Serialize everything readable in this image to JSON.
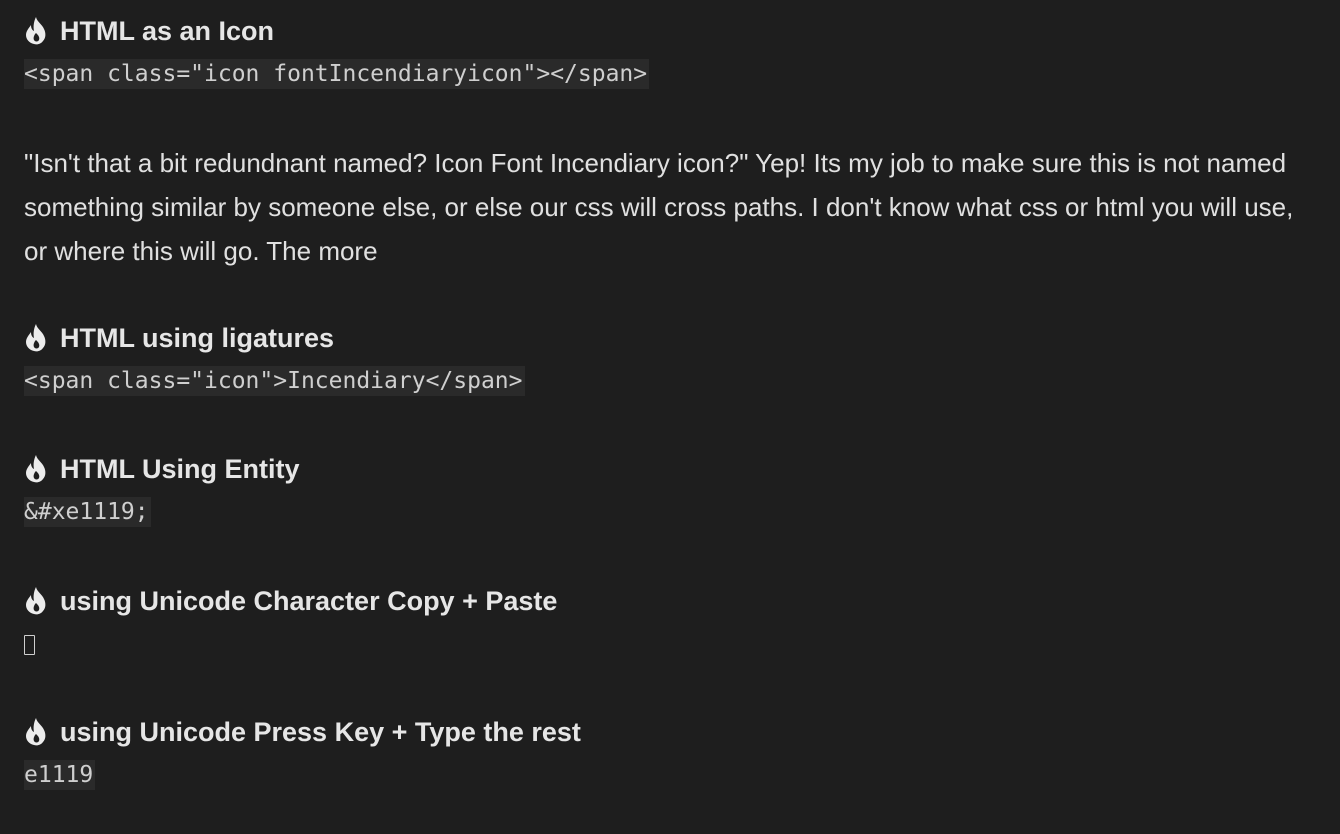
{
  "sections": [
    {
      "heading": "HTML as an Icon",
      "code": "<span class=\"icon fontIncendiaryicon\"></span>"
    },
    {
      "heading": "HTML using ligatures",
      "code": "<span class=\"icon\">Incendiary</span>"
    },
    {
      "heading": "HTML Using Entity",
      "code": "&#xe1119;"
    },
    {
      "heading": "using Unicode Character Copy + Paste",
      "code_glyph": "missing-glyph-box"
    },
    {
      "heading": "using Unicode Press Key + Type the rest",
      "code": "e1119"
    }
  ],
  "paragraph": "\"Isn't that a bit redundnant named? Icon Font Incendiary icon?\" Yep! Its my job to make sure this is not named something similar by someone else, or else our css will cross paths. I don't know what css or html you will use, or where this will go. The more",
  "icons": {
    "heading_icon": "flame-icon"
  },
  "colors": {
    "background": "#1e1e1e",
    "heading": "#e6e6e6",
    "text": "#e0e0e0",
    "code_bg": "#2a2a2a"
  }
}
